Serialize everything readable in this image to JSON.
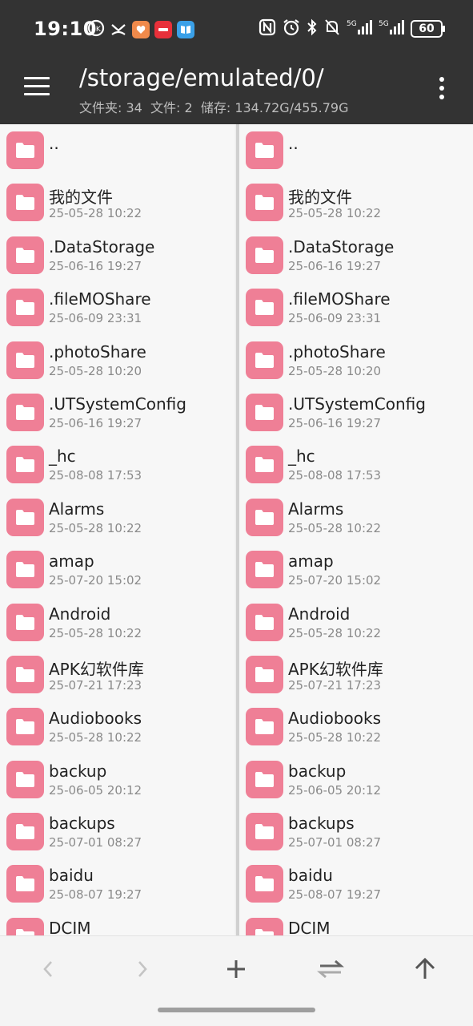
{
  "status_bar": {
    "time": "19:10",
    "battery": "60",
    "network": "5G"
  },
  "header": {
    "path": "/storage/emulated/0/",
    "summary": "文件夹: 34  文件: 2  储存: 134.72G/455.79G"
  },
  "colors": {
    "toolbar": "#333333",
    "folder": "#ef7f96",
    "background": "#f7f7f7"
  },
  "files": [
    {
      "name": "..",
      "date": ""
    },
    {
      "name": "我的文件",
      "date": "25-05-28 10:22"
    },
    {
      "name": ".DataStorage",
      "date": "25-06-16 19:27"
    },
    {
      "name": ".fileMOShare",
      "date": "25-06-09 23:31"
    },
    {
      "name": ".photoShare",
      "date": "25-05-28 10:20"
    },
    {
      "name": ".UTSystemConfig",
      "date": "25-06-16 19:27"
    },
    {
      "name": "_hc",
      "date": "25-08-08 17:53"
    },
    {
      "name": "Alarms",
      "date": "25-05-28 10:22"
    },
    {
      "name": "amap",
      "date": "25-07-20 15:02"
    },
    {
      "name": "Android",
      "date": "25-05-28 10:22"
    },
    {
      "name": "APK幻软件库",
      "date": "25-07-21 17:23"
    },
    {
      "name": "Audiobooks",
      "date": "25-05-28 10:22"
    },
    {
      "name": "backup",
      "date": "25-06-05 20:12"
    },
    {
      "name": "backups",
      "date": "25-07-01 08:27"
    },
    {
      "name": "baidu",
      "date": "25-08-07 19:27"
    },
    {
      "name": "DCIM",
      "date": ""
    }
  ],
  "bottom_bar": {
    "icons": [
      "back-arrow-icon",
      "forward-arrow-icon",
      "add-icon",
      "swap-icon",
      "up-arrow-icon"
    ]
  }
}
